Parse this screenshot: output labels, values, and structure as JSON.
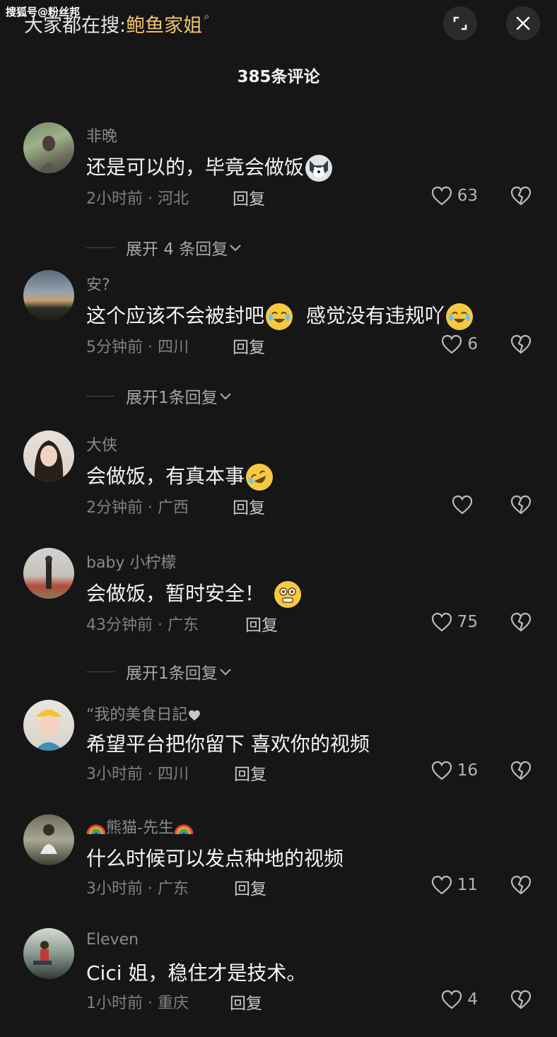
{
  "watermark": "搜狐号@粉丝邦",
  "search": {
    "prefix": "大家都在搜:",
    "term": "鲍鱼家姐",
    "glyph": "⌕"
  },
  "header": {
    "title": "385条评论"
  },
  "comments": [
    {
      "user": "非晚",
      "text": "还是可以的，毕竟会做饭",
      "time": "2小时前 · 河北",
      "reply": "回复",
      "likes": "63",
      "expand": "展开 4 条回复"
    },
    {
      "user": "安?",
      "text": "这个应该不会被封吧",
      "text2": "感觉没有违规吖",
      "time": "5分钟前 · 四川",
      "reply": "回复",
      "likes": "6",
      "expand": "展开1条回复"
    },
    {
      "user": "大侠",
      "text": "会做饭，有真本事",
      "time": "2分钟前 · 广西",
      "reply": "回复",
      "likes": ""
    },
    {
      "user": "baby 小柠檬",
      "text": "会做饭，暂时安全！",
      "time": "43分钟前 · 广东",
      "reply": "回复",
      "likes": "75",
      "expand": "展开1条回复"
    },
    {
      "user": "“我的美食日記",
      "text": "希望平台把你留下  喜欢你的视频",
      "time": "3小时前 · 四川",
      "reply": "回复",
      "likes": "16"
    },
    {
      "user": "熊猫-先生",
      "text": "什么时候可以发点种地的视频",
      "time": "3小时前 · 广东",
      "reply": "回复",
      "likes": "11"
    },
    {
      "user": "Eleven",
      "text": "Cici 姐，稳住才是技术。",
      "time": "1小时前 · 重庆",
      "reply": "回复",
      "likes": "4"
    }
  ],
  "icons": {
    "expand": "expand-icon",
    "close": "close-icon",
    "like": "heart-icon",
    "dislike": "broken-heart-icon",
    "chevron": "chevron-down-icon"
  },
  "colors": {
    "background": "#161616",
    "accent": "#f2c36b",
    "muted": "#808080"
  }
}
